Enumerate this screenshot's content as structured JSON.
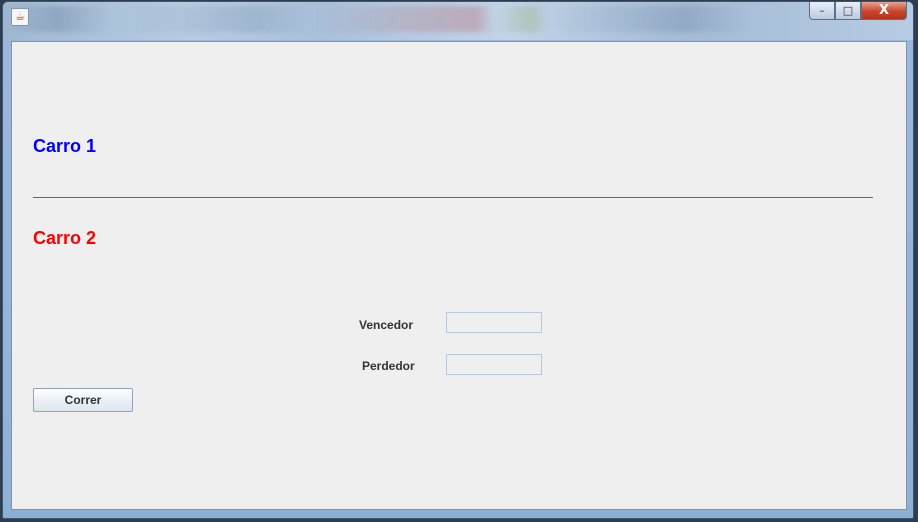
{
  "window": {
    "controls": {
      "minimize_glyph": "–",
      "maximize_glyph": "□",
      "close_glyph": "X"
    },
    "app_icon": "java-icon"
  },
  "race": {
    "car1_label": "Carro 1",
    "car2_label": "Carro 2",
    "car1_color": "#0000ff",
    "car2_color": "#ff0000"
  },
  "results": {
    "winner_label": "Vencedor",
    "winner_value": "",
    "loser_label": "Perdedor",
    "loser_value": ""
  },
  "actions": {
    "run_label": "Correr"
  }
}
